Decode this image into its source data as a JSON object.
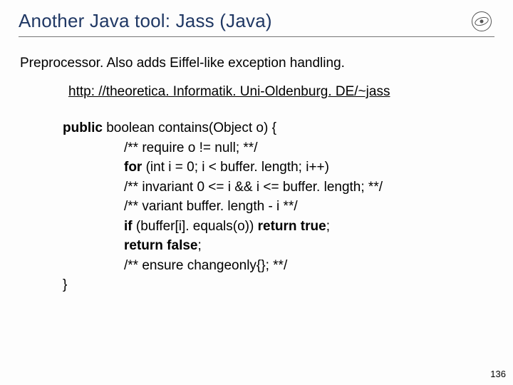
{
  "title": "Another Java tool: Jass (Java)",
  "intro": "Preprocessor. Also adds Eiffel-like exception handling.",
  "link": "http: //theoretica. Informatik. Uni-Oldenburg. DE/~jass",
  "code": {
    "kw_public": "public",
    "sig_mid": " boolean contains(Object o) {",
    "l1": "/** require o != null; **/",
    "kw_for": "for",
    "l2_rest": " (int i = 0; i < buffer. length; i++)",
    "l3": "/** invariant 0 <= i && i <= buffer. length; **/",
    "l4": "/** variant buffer. length - i **/",
    "kw_if": "if",
    "l5_mid": " (buffer[i]. equals(o)) ",
    "kw_return1": "return",
    "kw_true": " true",
    "semi": ";",
    "kw_return2": "return",
    "kw_false": " false",
    "l7": "/** ensure changeonly{}; **/",
    "close": "}"
  },
  "page_number": "136"
}
